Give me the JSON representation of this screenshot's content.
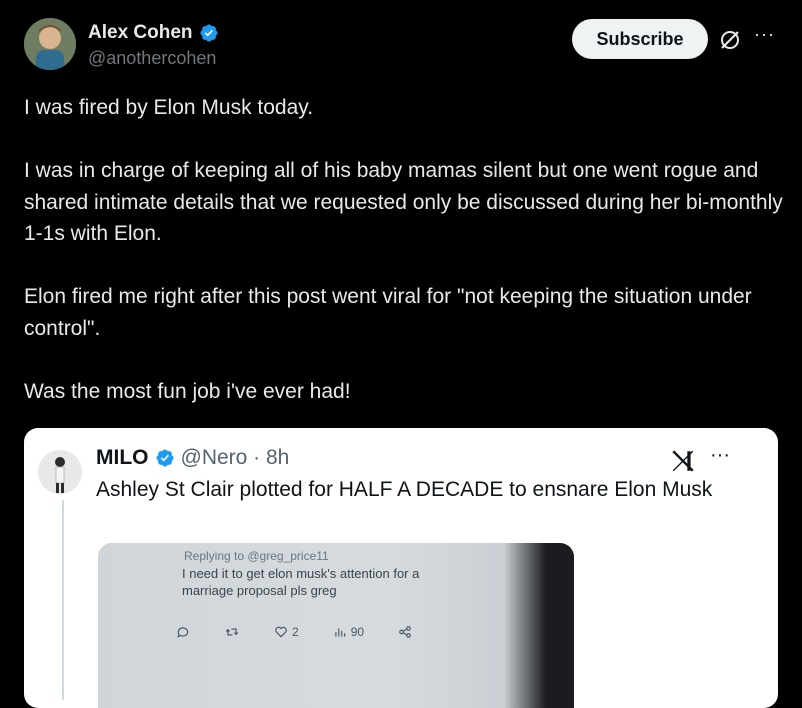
{
  "author": {
    "display_name": "Alex Cohen",
    "handle": "@anothercohen",
    "verified": true
  },
  "actions": {
    "subscribe_label": "Subscribe",
    "more_label": "···"
  },
  "tweet": {
    "paragraphs": [
      "I was fired by Elon Musk today.",
      "I was in charge of keeping all of his baby mamas silent but one went rogue and shared intimate details that we requested only be discussed during her bi-monthly 1-1s with Elon.",
      "Elon fired me right after this post went viral for \"not keeping the situation under control\".",
      "Was the most fun job i've ever had!"
    ]
  },
  "quote": {
    "display_name": "MILO",
    "handle_time": "@Nero · 8h",
    "text": "Ashley St Clair plotted for HALF A DECADE to ensnare Elon Musk",
    "more_label": "···",
    "media": {
      "replying": "Replying to @greg_price11",
      "text": "I need it to get elon musk's attention for a marriage proposal pls greg",
      "likes": "2",
      "views": "90"
    }
  },
  "colors": {
    "background": "#000000",
    "verified_blue": "#1d9bf0",
    "quote_background": "#ffffff"
  },
  "icons": [
    "verified-badge-icon",
    "grok-icon",
    "more-icon",
    "x-logo-icon",
    "reply-icon",
    "retweet-icon",
    "like-icon",
    "views-icon",
    "share-icon"
  ]
}
